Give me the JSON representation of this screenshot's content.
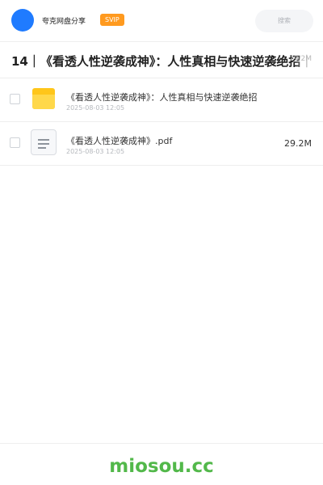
{
  "header": {
    "avatar_color": "#1f7bff",
    "brand": "夸克网盘分享",
    "badge": "SVIP",
    "search_placeholder": "搜索"
  },
  "title_bar": {
    "title": "14｜《看透人性逆袭成神》：人性真相与快速逆袭绝招｜",
    "meta": "29.2M"
  },
  "files": [
    {
      "icon": "folder-icon",
      "name": "《看透人性逆袭成神》：人性真相与快速逆袭绝招",
      "date": "2025-08-03 12:05",
      "size": ""
    },
    {
      "icon": "document-icon",
      "name": "《看透人性逆袭成神》.pdf",
      "date": "2025-08-03 12:05",
      "size": "29.2M"
    }
  ],
  "footer": {
    "watermark": "miosou.cc",
    "watermark_color": "#52b84a"
  }
}
